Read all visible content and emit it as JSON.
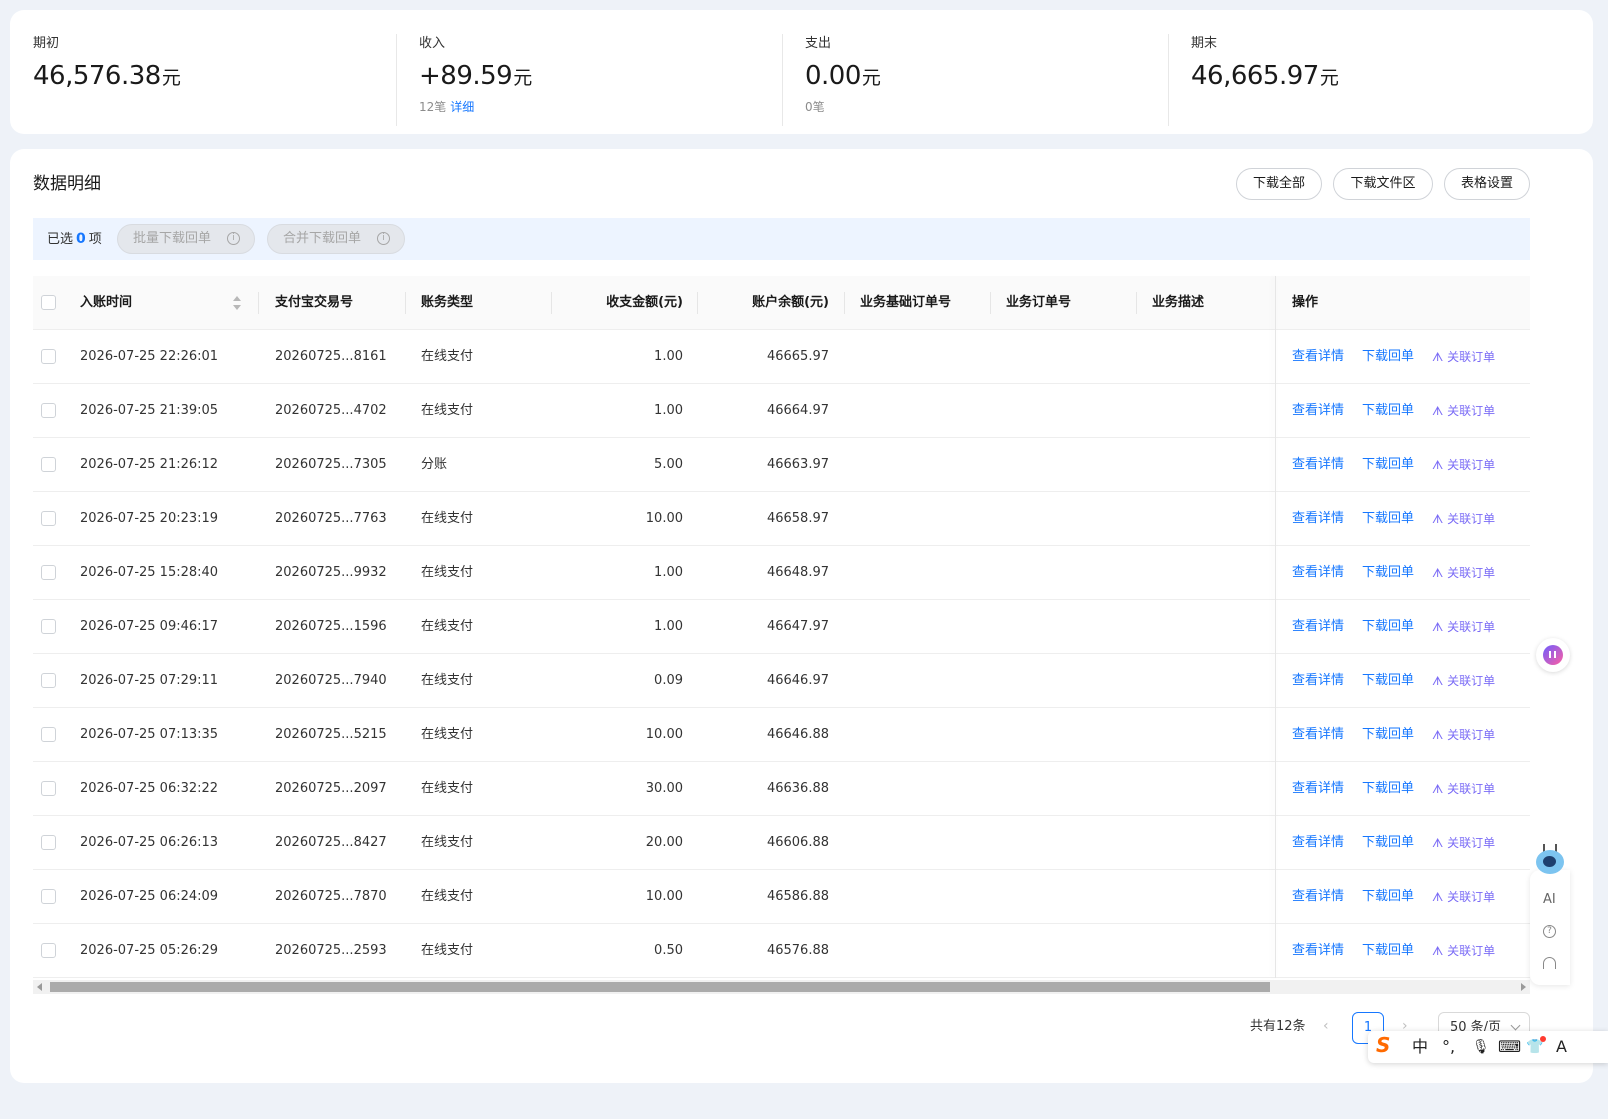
{
  "summary": [
    {
      "label": "期初",
      "value": "46,576.38",
      "unit": "元",
      "sub_count": "",
      "sub_link": ""
    },
    {
      "label": "收入",
      "value": "+89.59",
      "unit": "元",
      "sub_count": "12笔",
      "sub_link": "详细"
    },
    {
      "label": "支出",
      "value": "0.00",
      "unit": "元",
      "sub_count": "0笔",
      "sub_link": ""
    },
    {
      "label": "期末",
      "value": "46,665.97",
      "unit": "元",
      "sub_count": "",
      "sub_link": ""
    }
  ],
  "detail": {
    "title": "数据明细",
    "buttons": {
      "download_all": "下载全部",
      "download_folder": "下载文件区",
      "table_settings": "表格设置"
    }
  },
  "selection": {
    "prefix": "已选",
    "count": "0",
    "suffix": "项",
    "batch_download": "批量下载回单",
    "merge_download": "合并下载回单",
    "info_icon": "i"
  },
  "table": {
    "headers": {
      "time": "入账时间",
      "trade_no": "支付宝交易号",
      "type": "账务类型",
      "amount": "收支金额(元)",
      "balance": "账户余额(元)",
      "base_order": "业务基础订单号",
      "order": "业务订单号",
      "desc": "业务描述",
      "ops": "操作"
    },
    "ops": {
      "view": "查看详情",
      "download": "下载回单",
      "link": "关联订单",
      "link_icon": "ᗑ"
    },
    "rows": [
      {
        "time": "2026-07-25 22:26:01",
        "trade_no": "20260725...8161",
        "type": "在线支付",
        "amount": "1.00",
        "balance": "46665.97"
      },
      {
        "time": "2026-07-25 21:39:05",
        "trade_no": "20260725...4702",
        "type": "在线支付",
        "amount": "1.00",
        "balance": "46664.97"
      },
      {
        "time": "2026-07-25 21:26:12",
        "trade_no": "20260725...7305",
        "type": "分账",
        "amount": "5.00",
        "balance": "46663.97"
      },
      {
        "time": "2026-07-25 20:23:19",
        "trade_no": "20260725...7763",
        "type": "在线支付",
        "amount": "10.00",
        "balance": "46658.97"
      },
      {
        "time": "2026-07-25 15:28:40",
        "trade_no": "20260725...9932",
        "type": "在线支付",
        "amount": "1.00",
        "balance": "46648.97"
      },
      {
        "time": "2026-07-25 09:46:17",
        "trade_no": "20260725...1596",
        "type": "在线支付",
        "amount": "1.00",
        "balance": "46647.97"
      },
      {
        "time": "2026-07-25 07:29:11",
        "trade_no": "20260725...7940",
        "type": "在线支付",
        "amount": "0.09",
        "balance": "46646.97"
      },
      {
        "time": "2026-07-25 07:13:35",
        "trade_no": "20260725...5215",
        "type": "在线支付",
        "amount": "10.00",
        "balance": "46646.88"
      },
      {
        "time": "2026-07-25 06:32:22",
        "trade_no": "20260725...2097",
        "type": "在线支付",
        "amount": "30.00",
        "balance": "46636.88"
      },
      {
        "time": "2026-07-25 06:26:13",
        "trade_no": "20260725...8427",
        "type": "在线支付",
        "amount": "20.00",
        "balance": "46606.88"
      },
      {
        "time": "2026-07-25 06:24:09",
        "trade_no": "20260725...7870",
        "type": "在线支付",
        "amount": "10.00",
        "balance": "46586.88"
      },
      {
        "time": "2026-07-25 05:26:29",
        "trade_no": "20260725...2593",
        "type": "在线支付",
        "amount": "0.50",
        "balance": "46576.88"
      }
    ]
  },
  "pagination": {
    "total": "共有12条",
    "prev": "‹",
    "page": "1",
    "next": "›",
    "page_size": "50 条/页"
  },
  "side": {
    "ai": "AI",
    "help": "?"
  },
  "ime": {
    "chinese": "中",
    "punct": "°,",
    "mic": "🎙",
    "keyboard": "⌨",
    "skin": "👕",
    "more": "A"
  },
  "colors": {
    "accent": "#1677ff",
    "purple": "#7b6cf6",
    "selection_bg": "#edf4ff"
  },
  "icons": [
    "info-icon",
    "sort-icon",
    "link-order-icon",
    "chevron-down-icon",
    "ai-assistant-icon",
    "robot-icon",
    "help-icon",
    "headset-icon",
    "sogou-logo-icon",
    "mic-icon",
    "keyboard-icon",
    "skin-icon"
  ]
}
